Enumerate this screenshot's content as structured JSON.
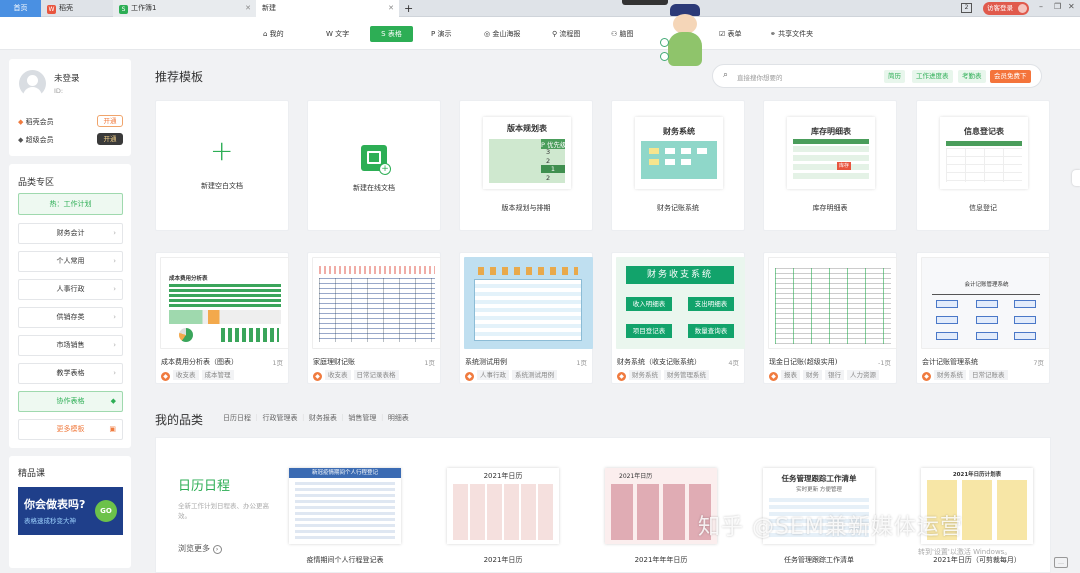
{
  "tabs": [
    {
      "label": "首页"
    },
    {
      "label": "稻壳"
    },
    {
      "label": "工作簿1"
    },
    {
      "label": "新建"
    }
  ],
  "titlebar": {
    "visitor": "访客登录"
  },
  "toolbar": [
    {
      "label": "我的"
    },
    {
      "label": "文字"
    },
    {
      "label": "表格"
    },
    {
      "label": "演示"
    },
    {
      "label": "金山海报"
    },
    {
      "label": "流程图"
    },
    {
      "label": "脑图"
    },
    {
      "label": "表单"
    },
    {
      "label": "共享文件夹"
    }
  ],
  "user": {
    "name": "未登录",
    "id": "ID:",
    "vip1": "稻壳会员",
    "vip1_btn": "开通",
    "vip2": "超级会员",
    "vip2_btn": "开通"
  },
  "category": {
    "title": "品类专区",
    "items": [
      {
        "label": "热：工作计划"
      },
      {
        "label": "财务会计"
      },
      {
        "label": "个人常用"
      },
      {
        "label": "人事行政"
      },
      {
        "label": "供销存类"
      },
      {
        "label": "市场销售"
      },
      {
        "label": "教学表格"
      },
      {
        "label": "协作表格"
      },
      {
        "label": "更多模板"
      }
    ]
  },
  "course": {
    "title": "精品课",
    "banner_line1": "你会做表吗?",
    "banner_line2": "表格速成秒变大神",
    "go": "GO"
  },
  "recommend": {
    "title": "推荐模板",
    "search_placeholder": "直接搜你想要的",
    "tags": [
      "简历",
      "工作进度表",
      "考勤表"
    ],
    "vip_tag": "会员免费下"
  },
  "row1": [
    {
      "label": "新建空白文档"
    },
    {
      "label": "新建在线文档"
    },
    {
      "label": "版本规划与排期",
      "thumb_title": "版本规划表",
      "sub": "P 优先级",
      "nums": [
        "3",
        "2",
        "1",
        "2"
      ]
    },
    {
      "label": "财务记账系统",
      "thumb_title": "财务系统"
    },
    {
      "label": "库存明细表",
      "thumb_title": "库存明细表",
      "badge": "库存"
    },
    {
      "label": "信息登记",
      "thumb_title": "信息登记表"
    }
  ],
  "row2": [
    {
      "label": "成本费用分析表（图表）",
      "pages": "1页",
      "tags": [
        "收支表",
        "成本管理"
      ],
      "thumb_title": "成本费用分析表"
    },
    {
      "label": "家庭理财记账",
      "pages": "1页",
      "tags": [
        "收支表",
        "日常记录表格"
      ]
    },
    {
      "label": "系统测试用例",
      "pages": "1页",
      "tags": [
        "人事行政",
        "系统测试用例"
      ]
    },
    {
      "label": "财务系统（收支记账系统）",
      "pages": "4页",
      "tags": [
        "财务系统",
        "财务管理系统"
      ],
      "thumb_title": "财务收支系统",
      "buttons": [
        "收入明细表",
        "支出明细表",
        "项目登记表",
        "数量查询表"
      ]
    },
    {
      "label": "现金日记账(超级实用)",
      "pages": "-1页",
      "tags": [
        "报表",
        "财务",
        "银行",
        "人力资源"
      ]
    },
    {
      "label": "会计记账管理系统",
      "pages": "7页",
      "tags": [
        "财务系统",
        "日常记账表"
      ],
      "thumb_title": "会计记账管理系统"
    }
  ],
  "mine": {
    "title": "我的品类",
    "tabs": [
      "日历日程",
      "行政管理表",
      "财务报表",
      "销售管理",
      "明细表"
    ],
    "feature_title": "日历日程",
    "feature_desc": "全新工作计划日程表、办公更高效。",
    "browse": "浏览更多",
    "items": [
      {
        "label": "疫情期间个人行程登记表",
        "thumb_title": "新冠疫情期间个人行程登记"
      },
      {
        "label": "2021年日历",
        "thumb_title": "2021年日历"
      },
      {
        "label": "2021年年年日历",
        "thumb_title": "2021年日历"
      },
      {
        "label": "任务管理跟踪工作清单",
        "thumb_title": "任务管理跟踪工作清单",
        "thumb_sub": "实时更新 方便管理"
      },
      {
        "label": "2021年日历（可剪裁每月）",
        "thumb_title": "2021年日历计划表"
      }
    ]
  },
  "watermark": "知乎 @SEM兼新媒体运营",
  "activate": "转到'设置'以激活 Windows。",
  "colors": {
    "green": "#2dae55",
    "orange": "#f4743b",
    "tabs_bg": "#dfe3e8"
  }
}
